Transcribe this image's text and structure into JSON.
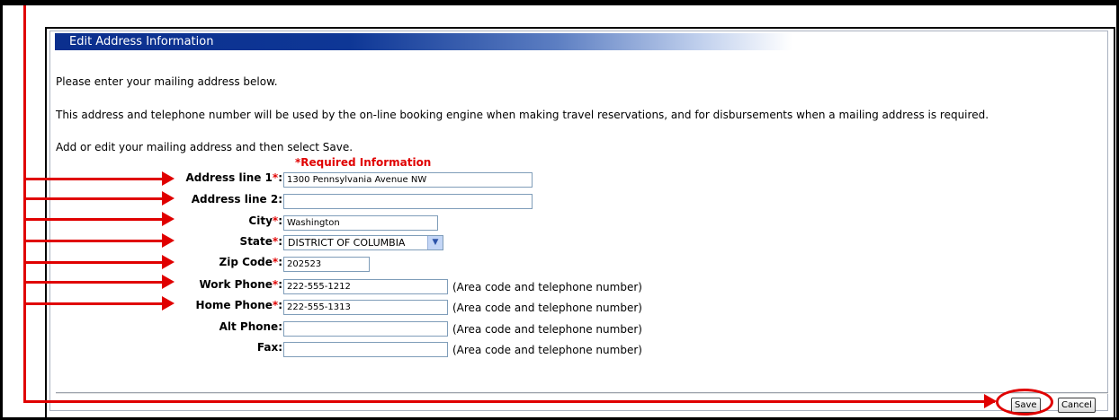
{
  "panel": {
    "title": "Edit Address Information",
    "intro": "Please enter your mailing address below.",
    "description": "This address and telephone number will be used by the on-line booking engine when making travel reservations, and for disbursements when a mailing address is required.",
    "instruction": "Add or edit your mailing address and then select Save.",
    "required_note": "*Required Information"
  },
  "form": {
    "required_marker": "*",
    "address1": {
      "label": "Address line 1",
      "suffix": ":",
      "value": "1300 Pennsylvania Avenue NW"
    },
    "address2": {
      "label": "Address line 2:",
      "value": ""
    },
    "city": {
      "label": "City",
      "suffix": ":",
      "value": "Washington"
    },
    "state": {
      "label": "State",
      "suffix": ":",
      "value": "DISTRICT OF COLUMBIA"
    },
    "zip": {
      "label": "Zip Code",
      "suffix": ":",
      "value": "202523"
    },
    "work_phone": {
      "label": "Work Phone",
      "suffix": ":",
      "value": "222-555-1212"
    },
    "home_phone": {
      "label": "Home Phone",
      "suffix": ":",
      "value": "222-555-1313"
    },
    "alt_phone": {
      "label": "Alt Phone:",
      "value": ""
    },
    "fax": {
      "label": "Fax:",
      "value": ""
    },
    "phone_hint": "(Area code and telephone number)"
  },
  "buttons": {
    "save": "Save",
    "cancel": "Cancel"
  },
  "annotation_color": "#e00000"
}
